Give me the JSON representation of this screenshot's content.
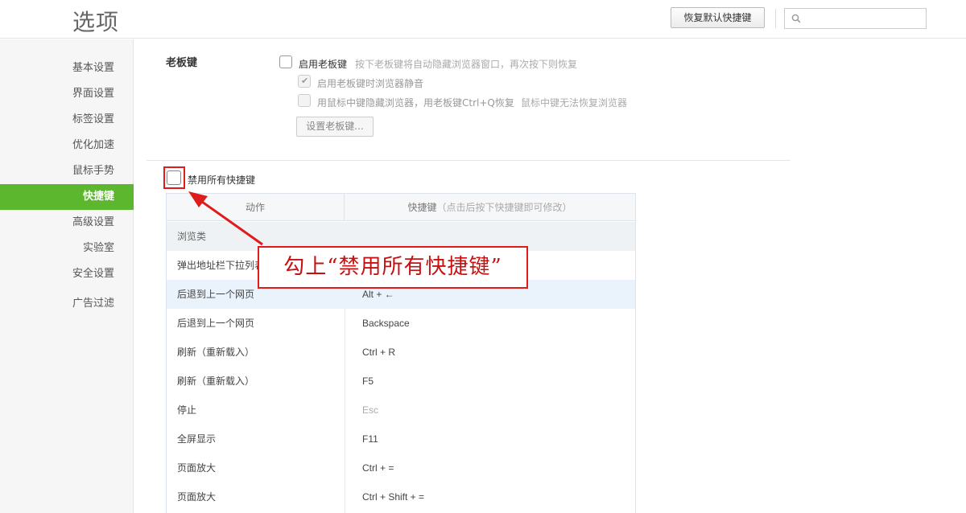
{
  "header": {
    "title": "选项",
    "reset_button": "恢复默认快捷键",
    "search_placeholder": ""
  },
  "sidebar": {
    "items": [
      {
        "label": "基本设置",
        "active": false
      },
      {
        "label": "界面设置",
        "active": false
      },
      {
        "label": "标签设置",
        "active": false
      },
      {
        "label": "优化加速",
        "active": false
      },
      {
        "label": "鼠标手势",
        "active": false
      },
      {
        "label": "快捷键",
        "active": true
      },
      {
        "label": "高级设置",
        "active": false
      },
      {
        "label": "实验室",
        "active": false
      },
      {
        "label": "安全设置",
        "active": false
      },
      {
        "label": "广告过滤",
        "active": false
      }
    ]
  },
  "boss_key": {
    "section_label": "老板键",
    "enable_label": "启用老板键",
    "enable_hint": "按下老板键将自动隐藏浏览器窗口，再次按下则恢复",
    "mute_label": "启用老板键时浏览器静音",
    "middle_click_label": "用鼠标中键隐藏浏览器，用老板键Ctrl+Q恢复",
    "middle_click_hint": "鼠标中键无法恢复浏览器",
    "set_button": "设置老板键..."
  },
  "disable_all": {
    "label": "禁用所有快捷键",
    "checked": false
  },
  "table": {
    "col_action": "动作",
    "col_key": "快捷键",
    "col_key_hint": "（点击后按下快捷键即可修改）",
    "category": "浏览类",
    "rows": [
      {
        "action": "弹出地址栏下拉列表",
        "key": ""
      },
      {
        "action": "后退到上一个网页",
        "key": "Alt + ←"
      },
      {
        "action": "后退到上一个网页",
        "key": "Backspace"
      },
      {
        "action": "刷新（重新载入）",
        "key": "Ctrl + R"
      },
      {
        "action": "刷新（重新载入）",
        "key": "F5"
      },
      {
        "action": "停止",
        "key": "Esc"
      },
      {
        "action": "全屏显示",
        "key": "F11"
      },
      {
        "action": "页面放大",
        "key": "Ctrl + ="
      },
      {
        "action": "页面放大",
        "key": "Ctrl + Shift + ="
      }
    ]
  },
  "annotation": {
    "text": "勾上“禁用所有快捷键”"
  },
  "colors": {
    "accent_green": "#5cb72f",
    "annotation_red": "#e01b1b",
    "row_highlight": "#eaf3fb"
  }
}
